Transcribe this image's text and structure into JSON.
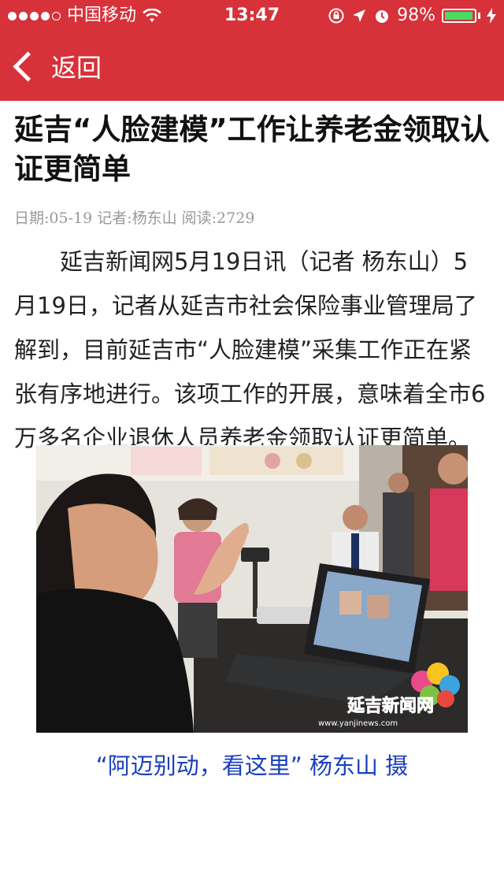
{
  "status_bar": {
    "carrier": "中国移动",
    "time": "13:47",
    "battery": "98%",
    "battery_level": 0.98
  },
  "navbar": {
    "back_label": "返回"
  },
  "article": {
    "title": "延吉“人脸建模”工作让养老金领取认证更简单",
    "meta": "日期:05-19 记者:杨东山 阅读:2729",
    "body": "延吉新闻网5月19日讯（记者 杨东山）5月19日，记者从延吉市社会保险事业管理局了解到，目前延吉市“人脸建模”采集工作正在紧张有序地进行。该项工作的开展，意味着全市6万多名企业退休人员养老金领取认证更简单。",
    "photo_watermark": "延吉新闻网",
    "photo_watermark_url": "www.yanjinews.com",
    "caption": "“阿迈别动，看这里” 杨东山 摄"
  }
}
